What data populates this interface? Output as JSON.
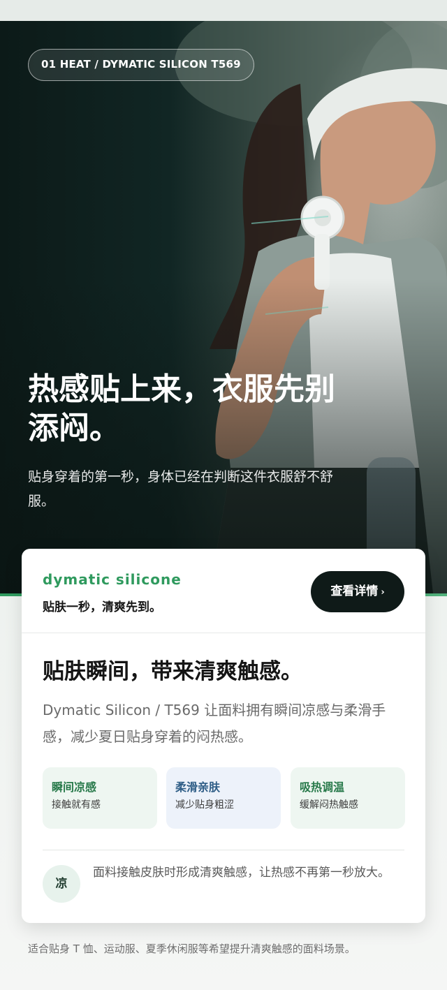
{
  "hero": {
    "tag": "01 HEAT / DYMATIC SILICON T569",
    "title": "热感贴上来，衣服先别添闷。",
    "subtitle": "贴身穿着的第一秒，身体已经在判断这件衣服舒不舒服。"
  },
  "card": {
    "brand": "dymatic silicone",
    "slogan": "贴肤一秒，清爽先到。",
    "detail_button": "查看详情",
    "title": "贴肤瞬间，带来清爽触感。",
    "body": "Dymatic Silicon / T569 让面料拥有瞬间凉感与柔滑手感，减少夏日贴身穿着的闷热感。",
    "features": [
      {
        "title": "瞬间凉感",
        "desc": "接触就有感"
      },
      {
        "title": "柔滑亲肤",
        "desc": "减少贴身粗涩"
      },
      {
        "title": "吸热调温",
        "desc": "缓解闷热触感"
      }
    ],
    "note": {
      "badge": "凉",
      "text": "面料接触皮肤时形成清爽触感，让热感不再第一秒放大。"
    }
  },
  "footnote": "适合贴身 T 恤、运动服、夏季休闲服等希望提升清爽触感的面料场景。",
  "colors": {
    "accent_green": "#2f9a5e",
    "button_dark": "#0f1a18",
    "feature_blue_text": "#2e5d86"
  },
  "icons": {
    "detail_chevron": "chevron-right-icon"
  }
}
